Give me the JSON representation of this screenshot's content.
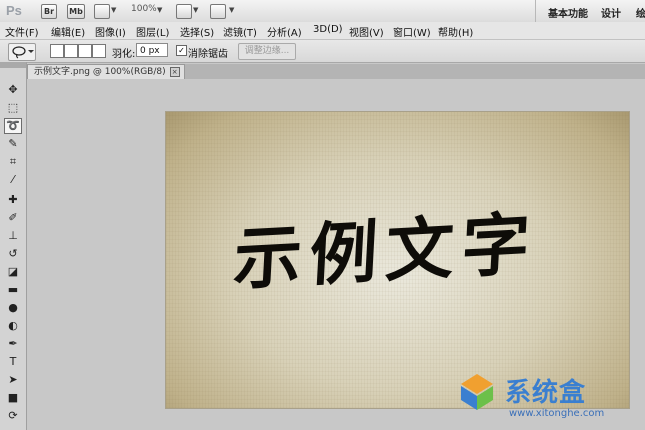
{
  "app": {
    "logo": "Ps",
    "bridge_label": "Br",
    "minibridge_label": "Mb",
    "zoom": "100%",
    "workspace_essentials": "基本功能",
    "workspace_design": "设计",
    "workspace_partial": "绘"
  },
  "menu": {
    "items": [
      "文件(F)",
      "编辑(E)",
      "图像(I)",
      "图层(L)",
      "选择(S)",
      "滤镜(T)",
      "分析(A)",
      "3D(D)",
      "视图(V)",
      "窗口(W)",
      "帮助(H)"
    ]
  },
  "options": {
    "feather_label": "羽化:",
    "feather_value": "0 px",
    "antialias_label": "消除锯齿",
    "antialias_checked": true,
    "refine_edge_label": "调整边缘..."
  },
  "document": {
    "tab_title": "示例文字.png @ 100%(RGB/8)",
    "close_glyph": "×"
  },
  "image": {
    "artwork_text": "示例文字"
  },
  "watermark": {
    "name": "系统盒",
    "url": "www.xitonghe.com"
  },
  "icons": {
    "move": "move-icon",
    "marquee": "rect-marquee-icon",
    "lasso": "lasso-icon",
    "quick-select": "quick-select-icon",
    "crop": "crop-icon",
    "eyedropper": "eyedropper-icon",
    "heal": "spot-heal-icon",
    "brush": "brush-icon",
    "stamp": "clone-stamp-icon",
    "history": "history-brush-icon",
    "eraser": "eraser-icon",
    "gradient": "gradient-icon",
    "blur": "blur-icon",
    "dodge": "dodge-icon",
    "pen": "pen-icon",
    "type": "type-icon",
    "path-select": "path-select-icon",
    "shape": "rectangle-shape-icon",
    "3d-rotate": "3d-rotate-icon",
    "3d-orbit": "3d-orbit-icon"
  },
  "colors": {
    "watermark_blue": "#3a7fd0",
    "watermark_orange": "#f0a030",
    "watermark_green": "#6cc04a"
  }
}
